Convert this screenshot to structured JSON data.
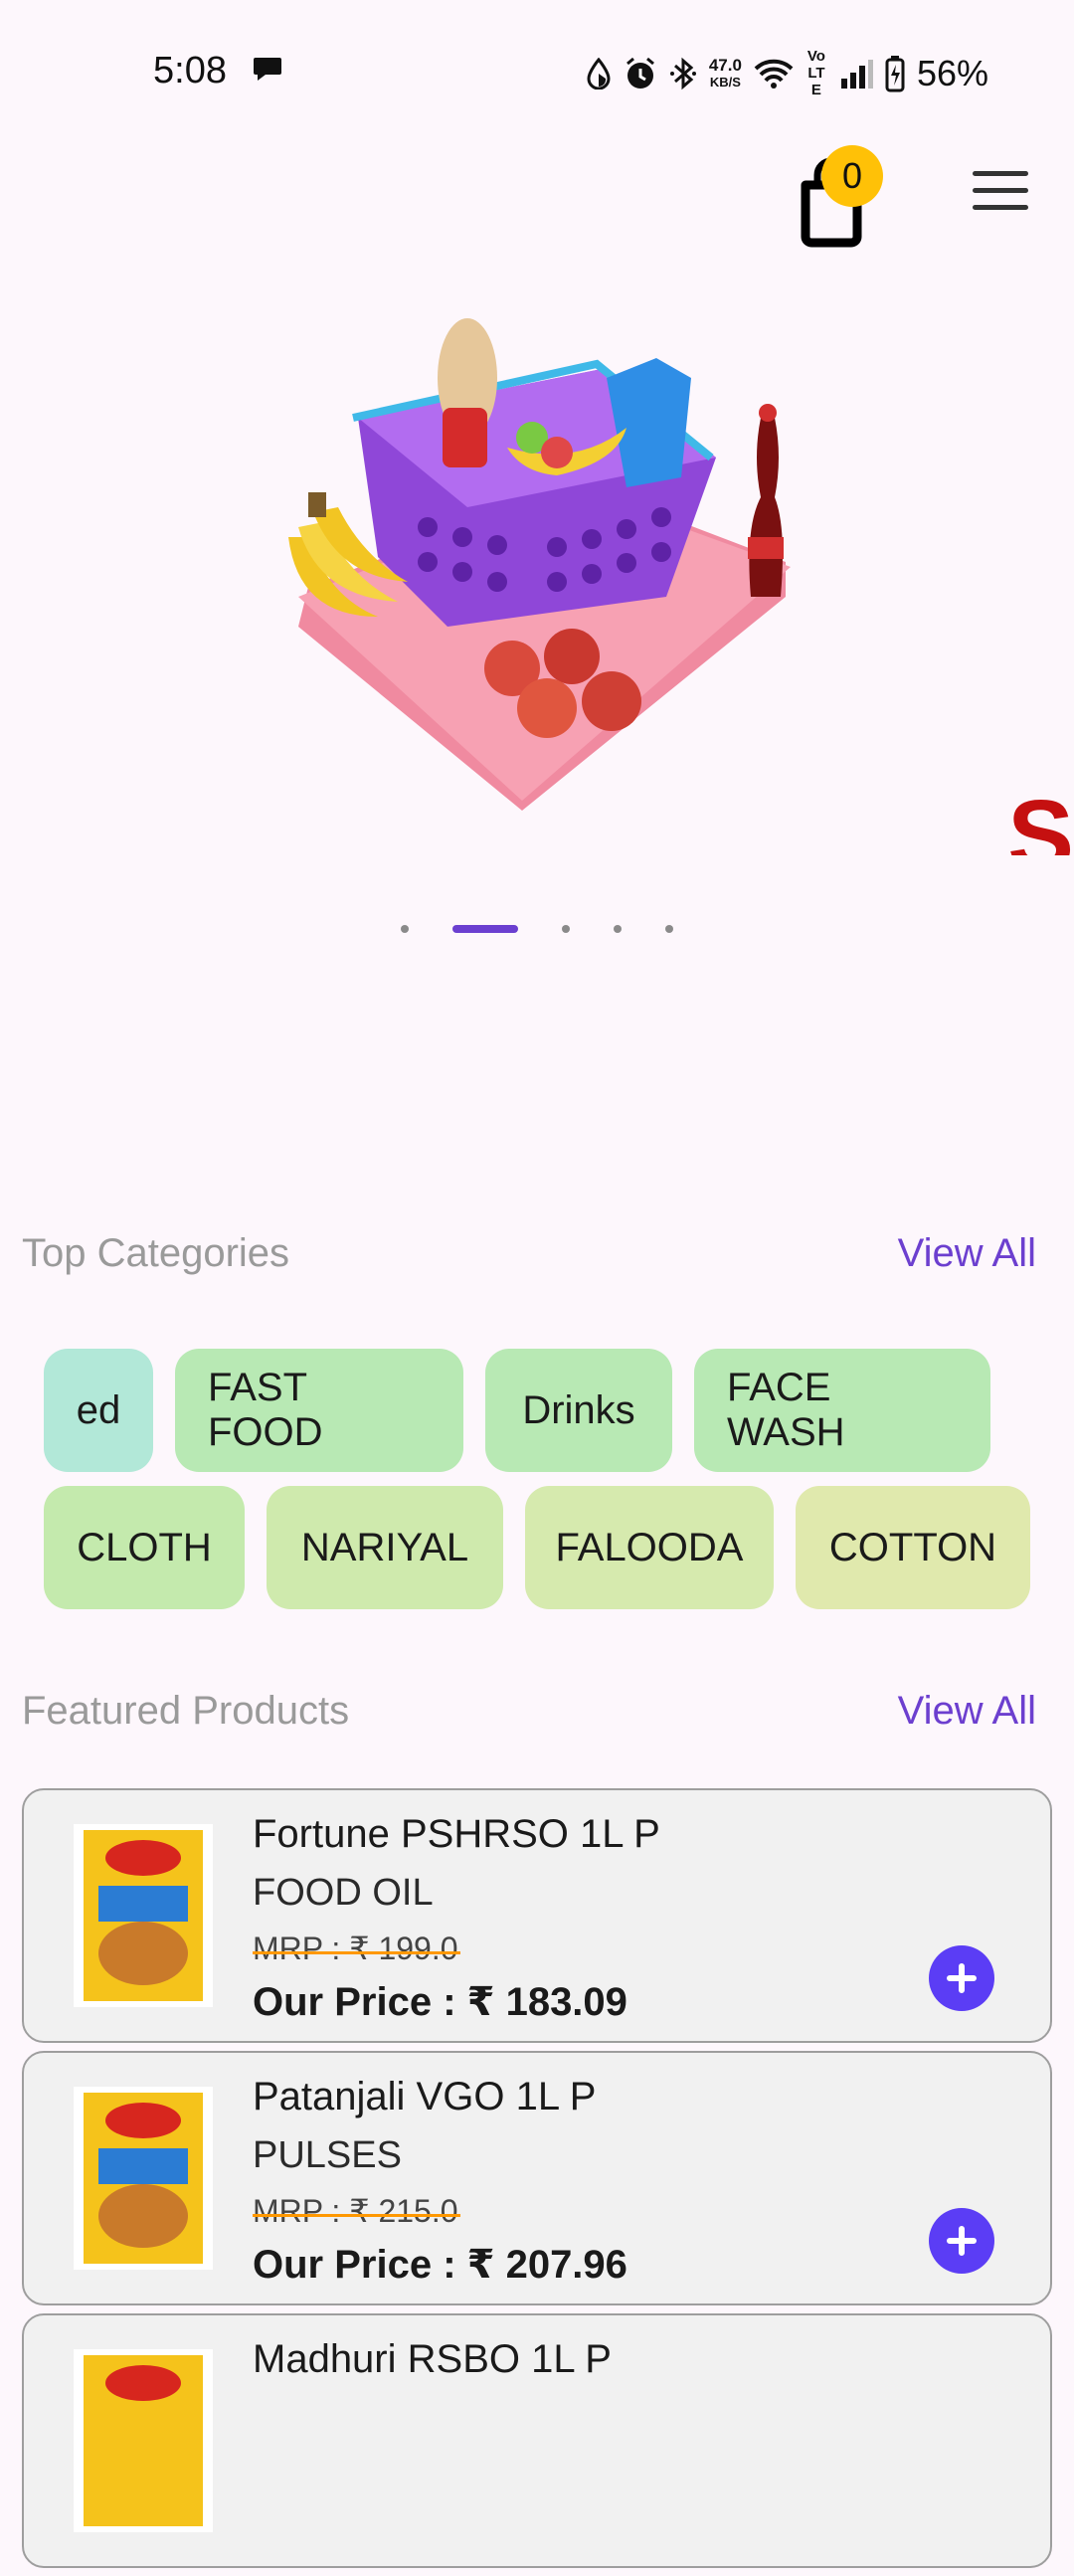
{
  "status_bar": {
    "time": "5:08",
    "net_speed_value": "47.0",
    "net_speed_unit": "KB/S",
    "volte": "Vo LTE",
    "battery": "56%"
  },
  "header": {
    "cart_count": "0",
    "cart_icon": "shopping-bag-icon",
    "menu_icon": "hamburger-menu-icon"
  },
  "banner": {
    "next_slide_letter": "S",
    "slide_count": 5,
    "active_slide": 2
  },
  "top_categories": {
    "title": "Top Categories",
    "view_all": "View All",
    "rows": [
      [
        {
          "label": "ed",
          "color": "#b2e8d8"
        },
        {
          "label": "FAST FOOD",
          "color": "#b8e9b4"
        },
        {
          "label": "Drinks",
          "color": "#b8e9b4"
        },
        {
          "label": "FACE WASH",
          "color": "#b8e9b4"
        }
      ],
      [
        {
          "label": "CLOTH",
          "color": "#c4eaad"
        },
        {
          "label": "NARIYAL",
          "color": "#cfeaad"
        },
        {
          "label": "FALOODA",
          "color": "#d6eaae"
        },
        {
          "label": "COTTON",
          "color": "#e0e9ad"
        }
      ]
    ]
  },
  "featured_products": {
    "title": "Featured Products",
    "view_all": "View All",
    "items": [
      {
        "name": "Fortune PSHRSO 1L P",
        "category": "FOOD OIL",
        "mrp": "MRP : ₹ 199.0",
        "price": "Our Price : ₹ 183.09"
      },
      {
        "name": "Patanjali VGO 1L P",
        "category": "PULSES",
        "mrp": "MRP : ₹ 215.0",
        "price": "Our Price : ₹ 207.96"
      },
      {
        "name": "Madhuri RSBO 1L P",
        "category": "",
        "mrp": "",
        "price": ""
      }
    ]
  },
  "colors": {
    "accent": "#6c3fcf",
    "add_button": "#5b3df5",
    "badge": "#ffc107",
    "strike": "#ff9800"
  }
}
